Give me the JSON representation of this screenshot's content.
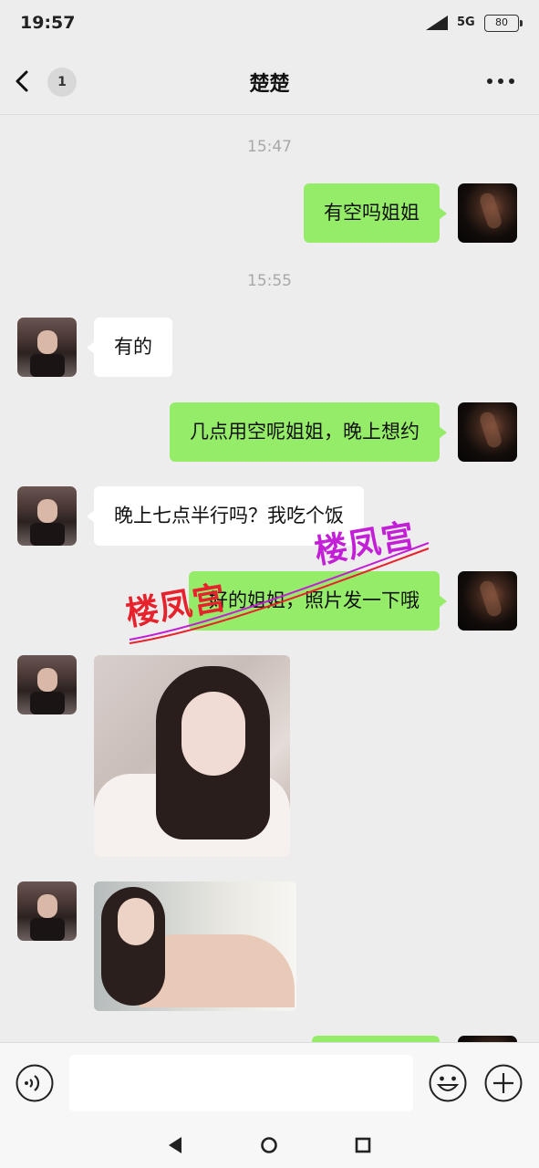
{
  "status_bar": {
    "time": "19:57",
    "network": "5G",
    "battery": "80"
  },
  "nav": {
    "unread_count": "1",
    "title": "楚楚"
  },
  "messages": {
    "time_1": "15:47",
    "m1": "有空吗姐姐",
    "time_2": "15:55",
    "m2": "有的",
    "m3": "几点用空呢姐姐，晚上想约",
    "m4": "晚上七点半行吗？我吃个饭",
    "m5": "好的姐姐，照片发一下哦"
  },
  "watermarks": {
    "wm1": "楼凤宫",
    "wm2": "楼凤宫"
  },
  "colors": {
    "sent_bubble": "#95ec69",
    "received_bubble": "#ffffff",
    "background": "#ededed",
    "watermark_red": "#e8222d",
    "watermark_purple": "#c21fd6"
  },
  "icons": [
    "chevron-left-icon",
    "more-icon",
    "voice-icon",
    "emoji-icon",
    "plus-icon",
    "signal-icon",
    "battery-icon",
    "nav-back-icon",
    "nav-home-icon",
    "nav-recent-icon"
  ],
  "input": {
    "value": ""
  }
}
